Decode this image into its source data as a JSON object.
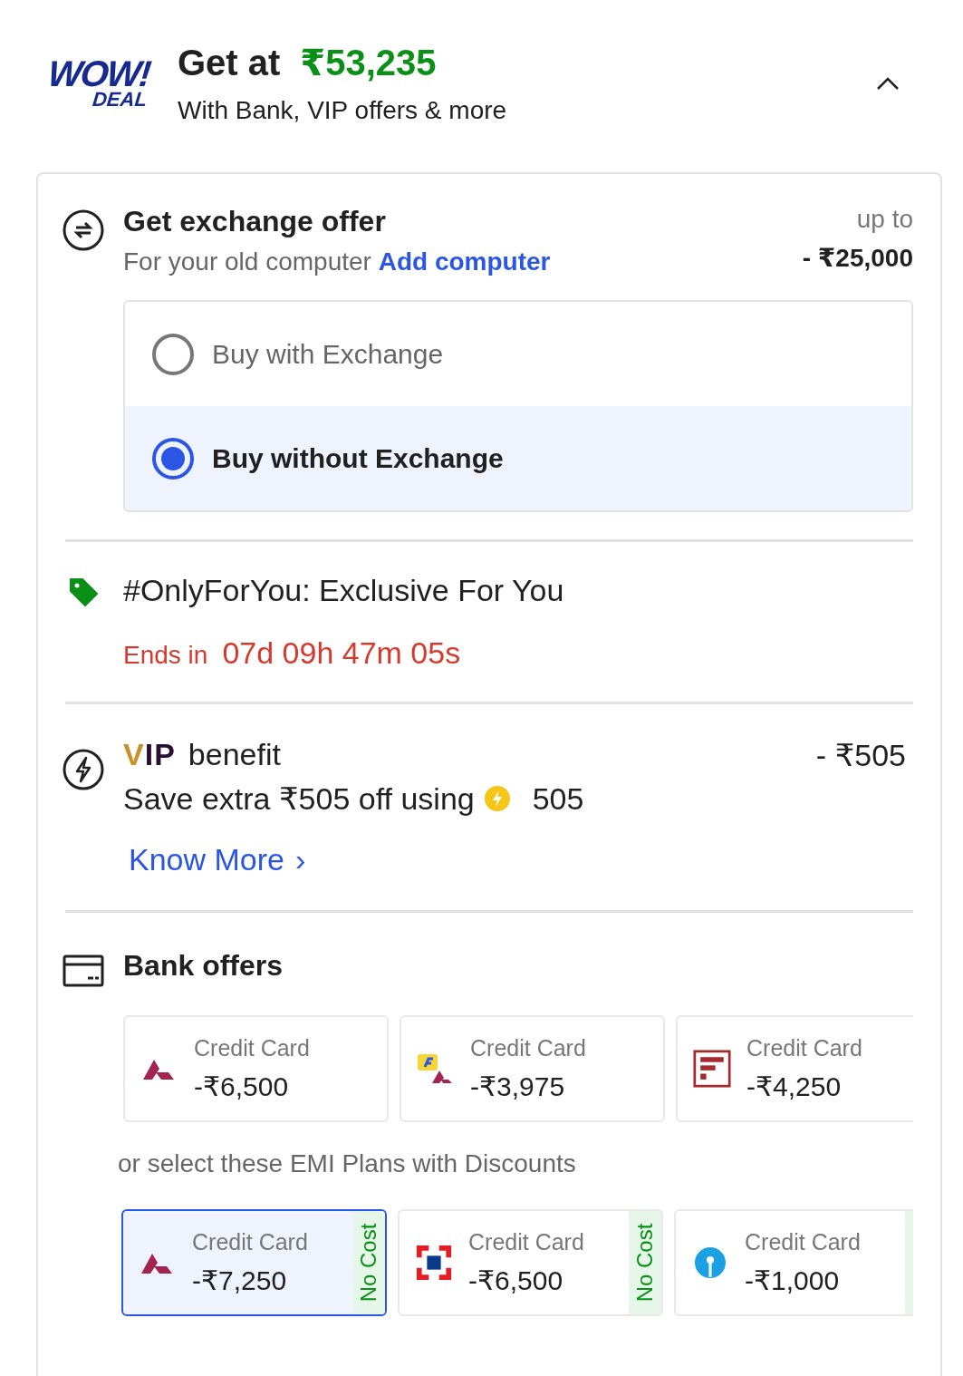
{
  "deal": {
    "logo_top": "WOW!",
    "logo_bottom": "DEAL",
    "title_prefix": "Get at",
    "price": "₹53,235",
    "subtitle": "With Bank, VIP offers & more",
    "expanded": true
  },
  "exchange": {
    "title": "Get exchange offer",
    "subtitle": "For your old computer",
    "link": "Add computer",
    "amount_label": "up to",
    "amount": "- ₹25,000",
    "options": [
      {
        "label": "Buy with Exchange",
        "selected": false
      },
      {
        "label": "Buy without Exchange",
        "selected": true
      }
    ]
  },
  "exclusive": {
    "title": "#OnlyForYou: Exclusive For You",
    "ends_label": "Ends in",
    "countdown": "07d 09h 47m 05s"
  },
  "vip": {
    "logo": "VIP",
    "title": "benefit",
    "amount": "- ₹505",
    "text": "Save extra ₹505 off using",
    "coins": "505",
    "link": "Know More",
    "link_arrow": "›"
  },
  "bank": {
    "title": "Bank offers",
    "offers": [
      {
        "kind": "axis",
        "label": "Credit Card",
        "amount": "-₹6,500"
      },
      {
        "kind": "flipkart",
        "label": "Credit Card",
        "amount": "-₹3,975"
      },
      {
        "kind": "federal",
        "label": "Credit Card",
        "amount": "-₹4,250"
      }
    ],
    "emi_caption": "or select these EMI Plans with Discounts",
    "emi_plans": [
      {
        "kind": "axis",
        "label": "Credit Card",
        "amount": "-₹7,250",
        "badge": "No Cost",
        "selected": true
      },
      {
        "kind": "hdfc",
        "label": "Credit Card",
        "amount": "-₹6,500",
        "badge": "No Cost",
        "selected": false
      },
      {
        "kind": "sbi",
        "label": "Credit Card",
        "amount": "-₹1,000",
        "selected": false
      }
    ]
  }
}
